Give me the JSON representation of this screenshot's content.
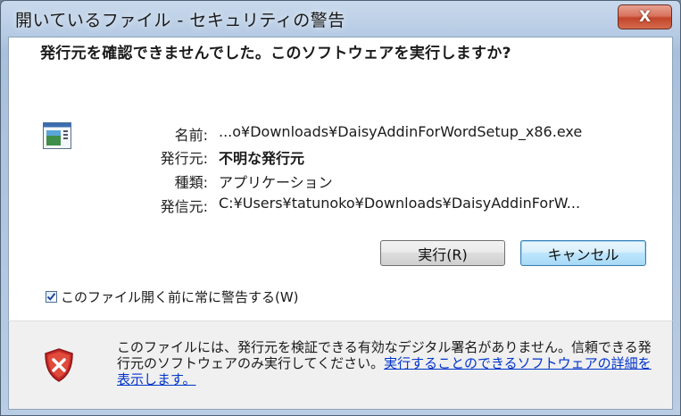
{
  "window": {
    "title": "開いているファイル - セキュリティの警告",
    "close_label": "X"
  },
  "dialog": {
    "heading": "発行元を確認できませんでした。このソフトウェアを実行しますか?",
    "properties": [
      {
        "label": "名前:",
        "value": "...o¥Downloads¥DaisyAddinForWordSetup_x86.exe"
      },
      {
        "label": "発行元:",
        "value": "不明な発行元"
      },
      {
        "label": "種類:",
        "value": "アプリケーション"
      },
      {
        "label": "発信元:",
        "value": "C:¥Users¥tatunoko¥Downloads¥DaisyAddinForW..."
      }
    ],
    "run_label": "実行(R)",
    "cancel_label": "キャンセル",
    "checkbox_label": "このファイル開く前に常に警告する(W)",
    "checkbox_checked": true
  },
  "warning": {
    "text": "このファイルには、発行元を検証できる有効なデジタル署名がありません。信頼できる発行元のソフトウェアのみ実行してください。",
    "link_text": "実行することのできるソフトウェアの詳細を表示します。",
    "icon": "shield-error-icon"
  },
  "colors": {
    "link": "#0033cc",
    "close_button": "#c2452a",
    "shield": "#c62a2a"
  }
}
